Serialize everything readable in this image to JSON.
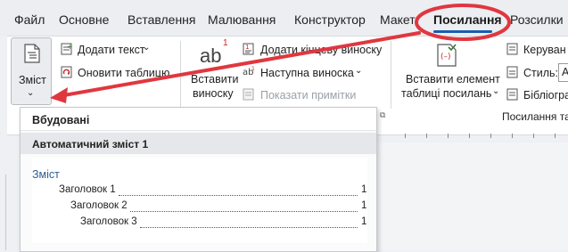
{
  "tabs": [
    {
      "label": "Файл"
    },
    {
      "label": "Основне"
    },
    {
      "label": "Вставлення"
    },
    {
      "label": "Малювання"
    },
    {
      "label": "Конструктор"
    },
    {
      "label": "Макет"
    },
    {
      "label": "Посилання"
    },
    {
      "label": "Розсилки"
    }
  ],
  "ribbon": {
    "toc_label": "Зміст",
    "add_text": "Додати текст",
    "update_table": "Оновити таблицю",
    "insert_footnote_line1": "Вставити",
    "insert_footnote_line2": "виноску",
    "endnote": "Додати кінцеву виноску",
    "next_footnote": "Наступна виноска",
    "show_notes": "Показати примітки",
    "insert_citation_line1": "Вставити елемент",
    "insert_citation_line2": "таблиці посилань",
    "manage": "Керуван",
    "style_label": "Стиль:",
    "style_value": "A",
    "bibliography": "Бібліогра",
    "group_label": "Посилання та",
    "ab_glyph": "ab",
    "superscript": "1"
  },
  "dropdown": {
    "title": "Вбудовані",
    "subtitle": "Автоматичний зміст 1",
    "preview_heading": "Зміст",
    "entries": [
      {
        "text": "Заголовок 1",
        "page": "1"
      },
      {
        "text": "Заголовок 2",
        "page": "1"
      },
      {
        "text": "Заголовок 3",
        "page": "1"
      }
    ]
  },
  "colors": {
    "accent": "#1c5cb0",
    "annotation_red": "#e0373f"
  },
  "icons": [
    "document-toc-icon",
    "add-text-icon",
    "update-table-icon",
    "endnote-icon",
    "next-footnote-icon",
    "show-notes-icon",
    "insert-citation-icon",
    "manage-sources-icon",
    "bibliography-icon"
  ]
}
